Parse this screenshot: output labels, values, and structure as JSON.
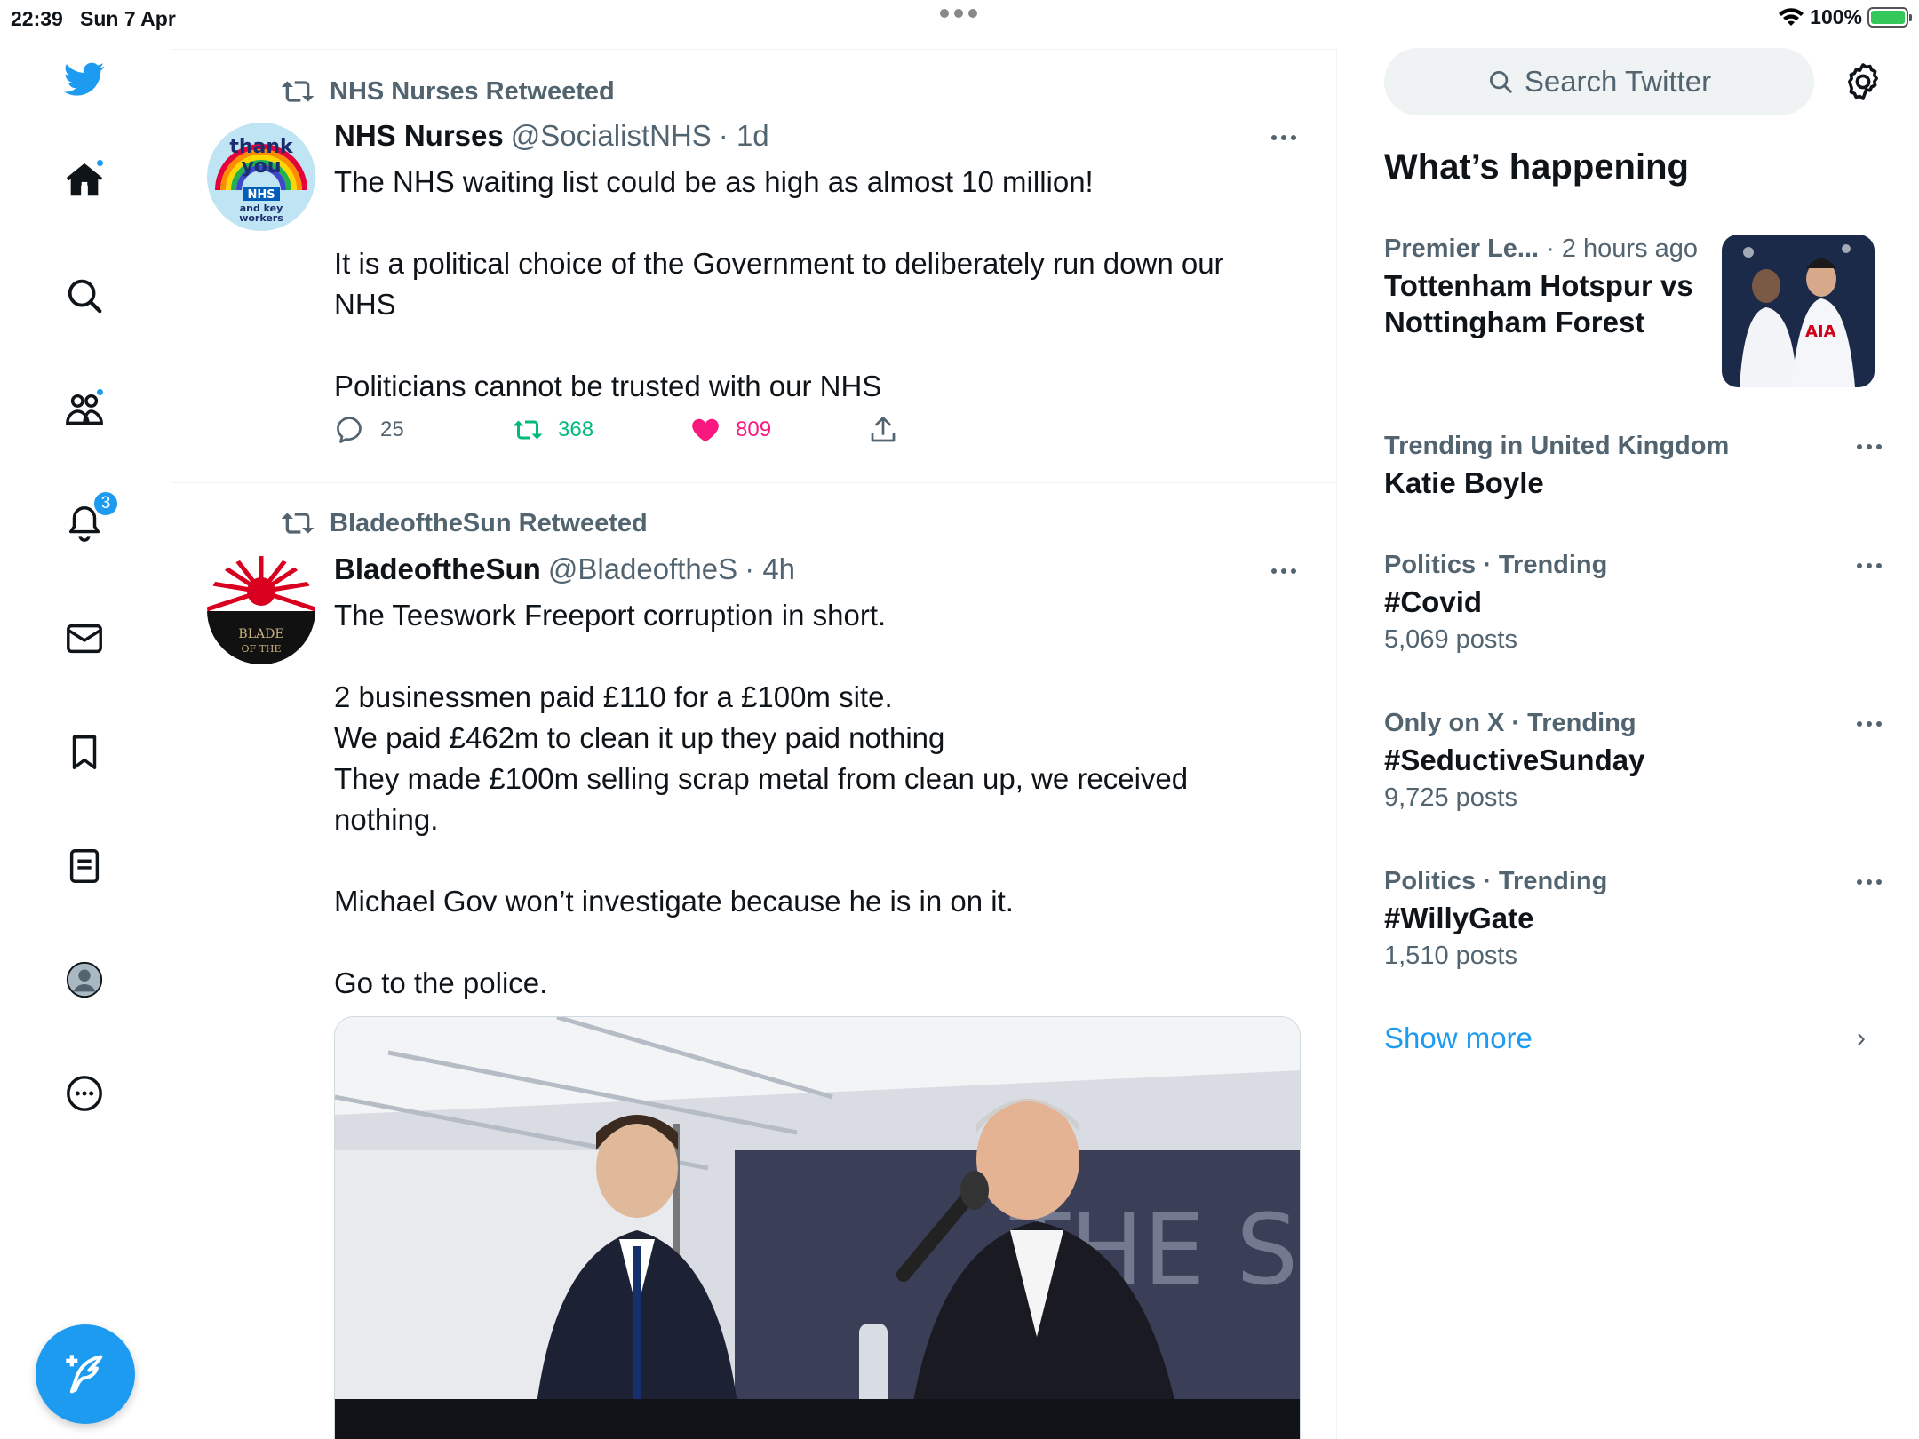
{
  "status": {
    "time": "22:39",
    "date": "Sun 7 Apr",
    "battery": "100%"
  },
  "nav": {
    "notifications_badge": "3"
  },
  "tweets": [
    {
      "retweeted_by": "NHS Nurses Retweeted",
      "name": "NHS Nurses",
      "handle": "@SocialistNHS",
      "time": "· 1d",
      "lines": [
        "The NHS waiting list could be as high as almost 10 million!",
        "",
        "It is a political choice of the Government to deliberately run down our",
        "NHS",
        "",
        "Politicians cannot be trusted with our NHS"
      ],
      "replies": "25",
      "retweets": "368",
      "likes": "809",
      "avatar_text": [
        "thank",
        "you",
        "NHS",
        "and key",
        "workers"
      ]
    },
    {
      "retweeted_by": "BladeoftheSun Retweeted",
      "name": "BladeoftheSun",
      "handle": "@BladeoftheS",
      "time": "· 4h",
      "lines": [
        "The Teeswork Freeport corruption in short.",
        "",
        "2 businessmen paid £110 for a £100m site.",
        "We paid £462m to clean it up they paid nothing",
        "They made £100m selling scrap metal from clean up, we received",
        "nothing.",
        "",
        "Michael Gov won’t investigate because he is in on it.",
        "",
        "Go to the police."
      ],
      "avatar_text": [
        "BLADE",
        "OF THE"
      ],
      "media_text": "THE SLAG"
    }
  ],
  "sidebar": {
    "search_placeholder": "Search Twitter",
    "whats_happening": "What’s happening",
    "trends": [
      {
        "category": "Premier Le...",
        "suffix": " · 2 hours ago",
        "title": "Tottenham Hotspur vs Nottingham Forest",
        "count": "",
        "image_text": "AIA"
      },
      {
        "category": "Trending in United Kingdom",
        "suffix": "",
        "title": "Katie Boyle",
        "count": ""
      },
      {
        "category": "Politics · Trending",
        "suffix": "",
        "title": "#Covid",
        "count": "5,069 posts"
      },
      {
        "category": "Only on X · Trending",
        "suffix": "",
        "title": "#SeductiveSunday",
        "count": "9,725 posts"
      },
      {
        "category": "Politics · Trending",
        "suffix": "",
        "title": "#WillyGate",
        "count": "1,510 posts"
      }
    ],
    "show_more": "Show more"
  },
  "colors": {
    "accent": "#1d9bf0",
    "retweet": "#00ba7c",
    "like": "#f91880",
    "muted": "#536471"
  }
}
